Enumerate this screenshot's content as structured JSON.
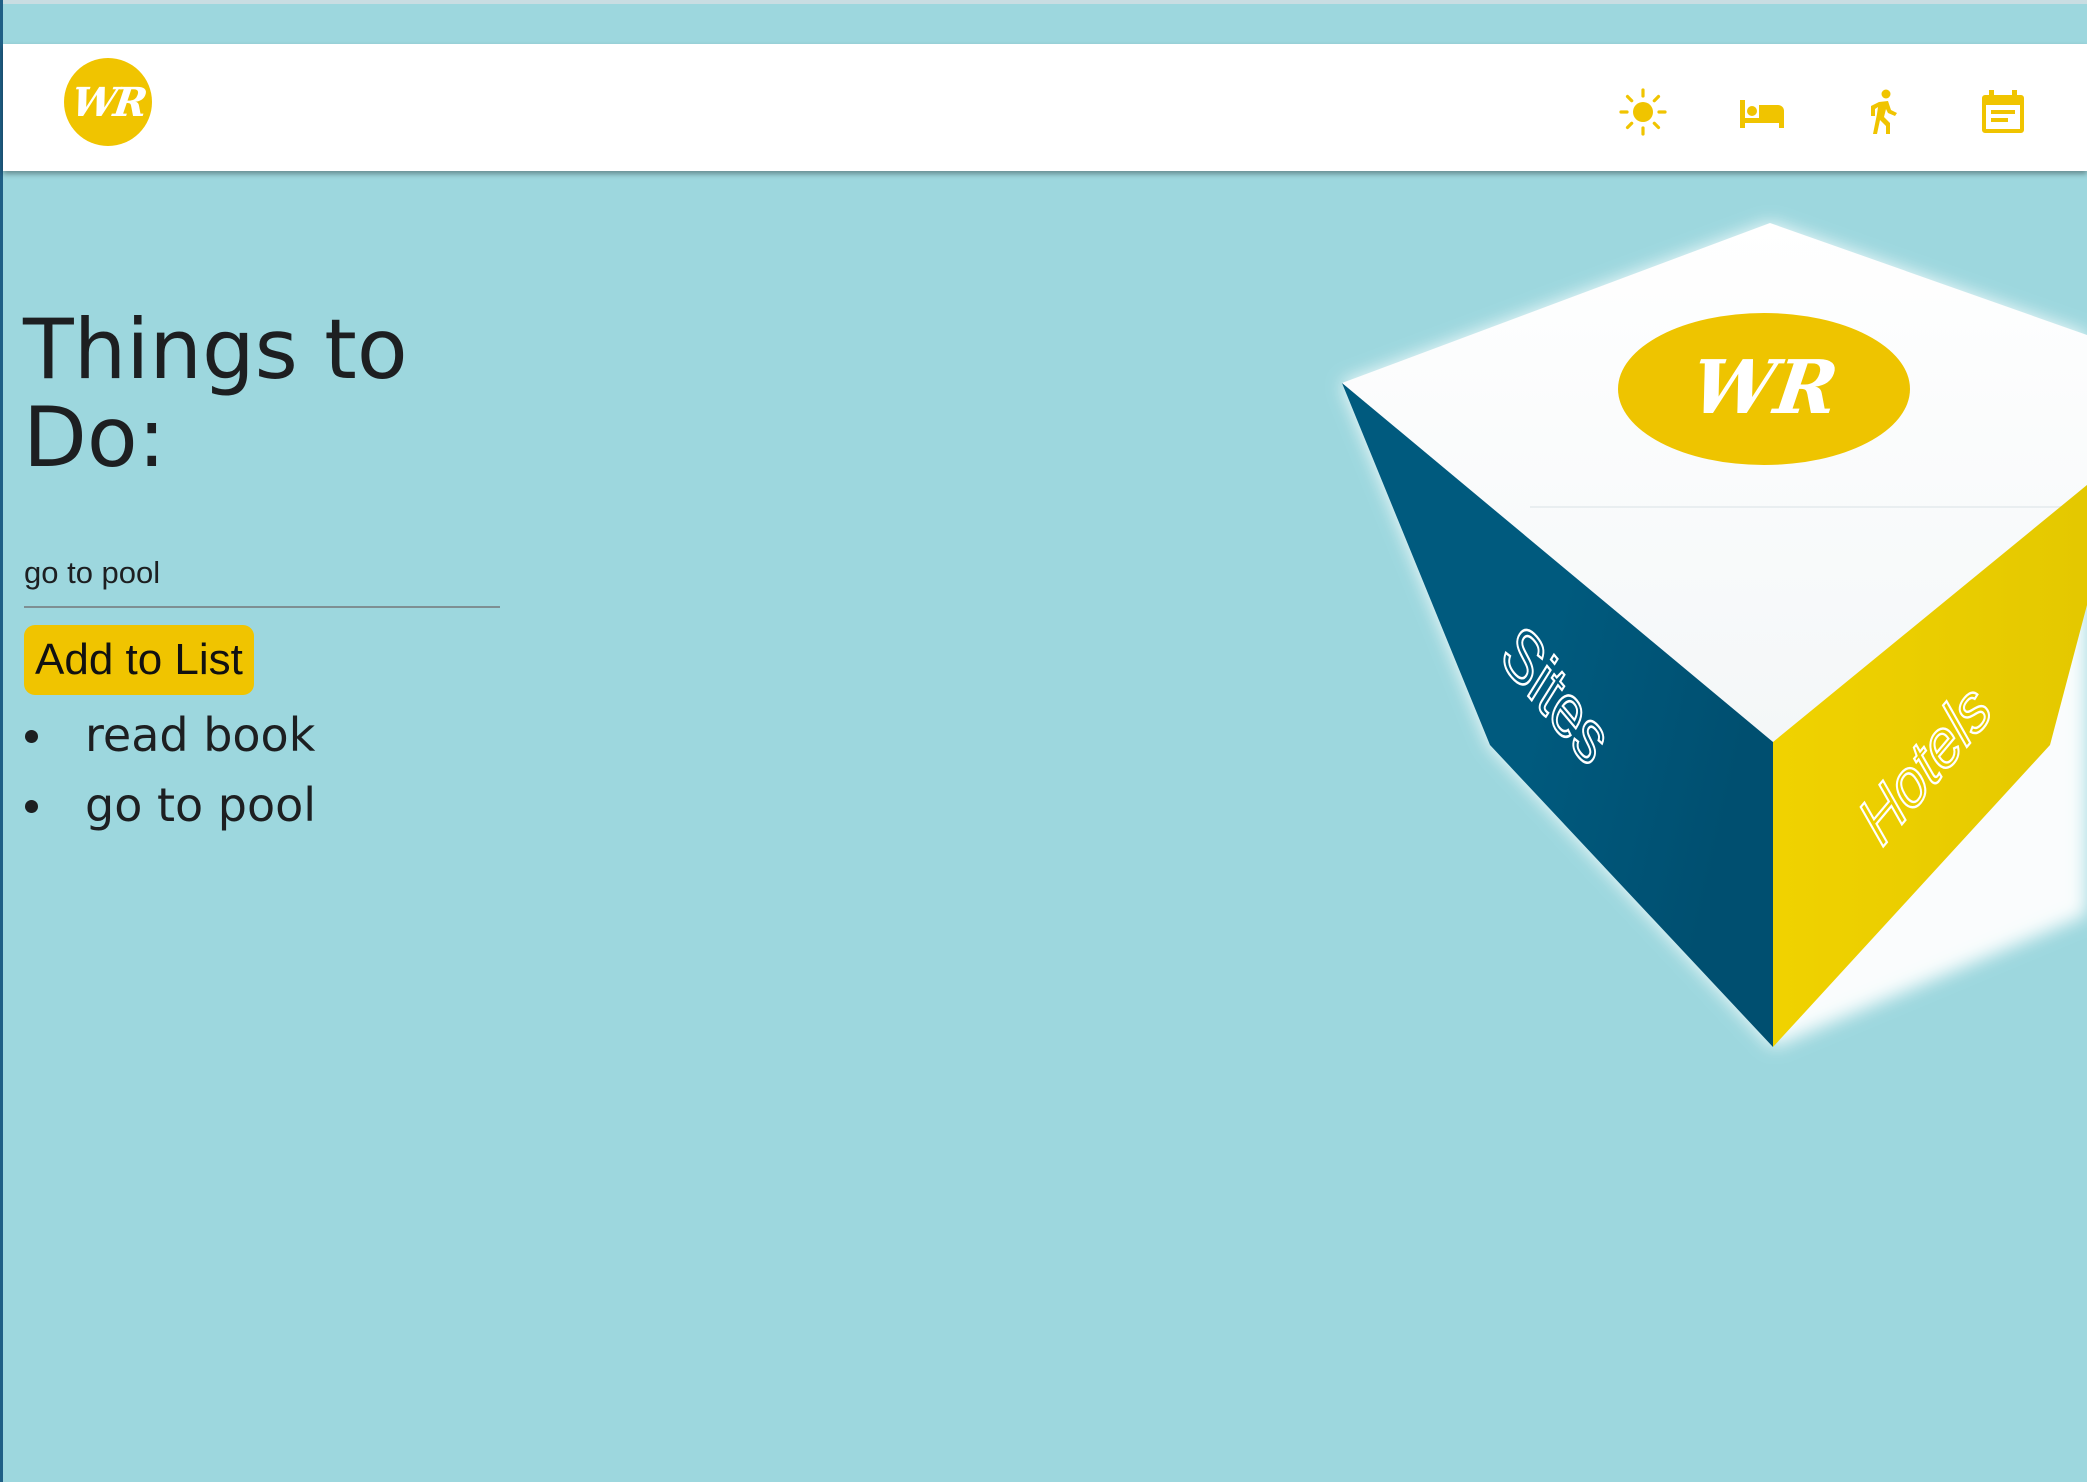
{
  "colors": {
    "background": "#9dd7de",
    "accent_yellow": "#f0c400",
    "cube_blue": "#005a7e",
    "cube_yellow": "#ecd100",
    "text_dark": "#1d1f21"
  },
  "navbar": {
    "logo_text": "WR",
    "icons": [
      {
        "name": "sun-icon"
      },
      {
        "name": "bed-icon"
      },
      {
        "name": "walking-person-icon"
      },
      {
        "name": "calendar-icon"
      }
    ]
  },
  "main": {
    "heading": "Things to Do:",
    "input_value": "go to pool",
    "add_button_label": "Add to List",
    "todos": [
      "read book",
      "go to pool"
    ]
  },
  "cube": {
    "top_logo": "WR",
    "left_face_label": "Sites",
    "right_face_label": "Hotels"
  }
}
